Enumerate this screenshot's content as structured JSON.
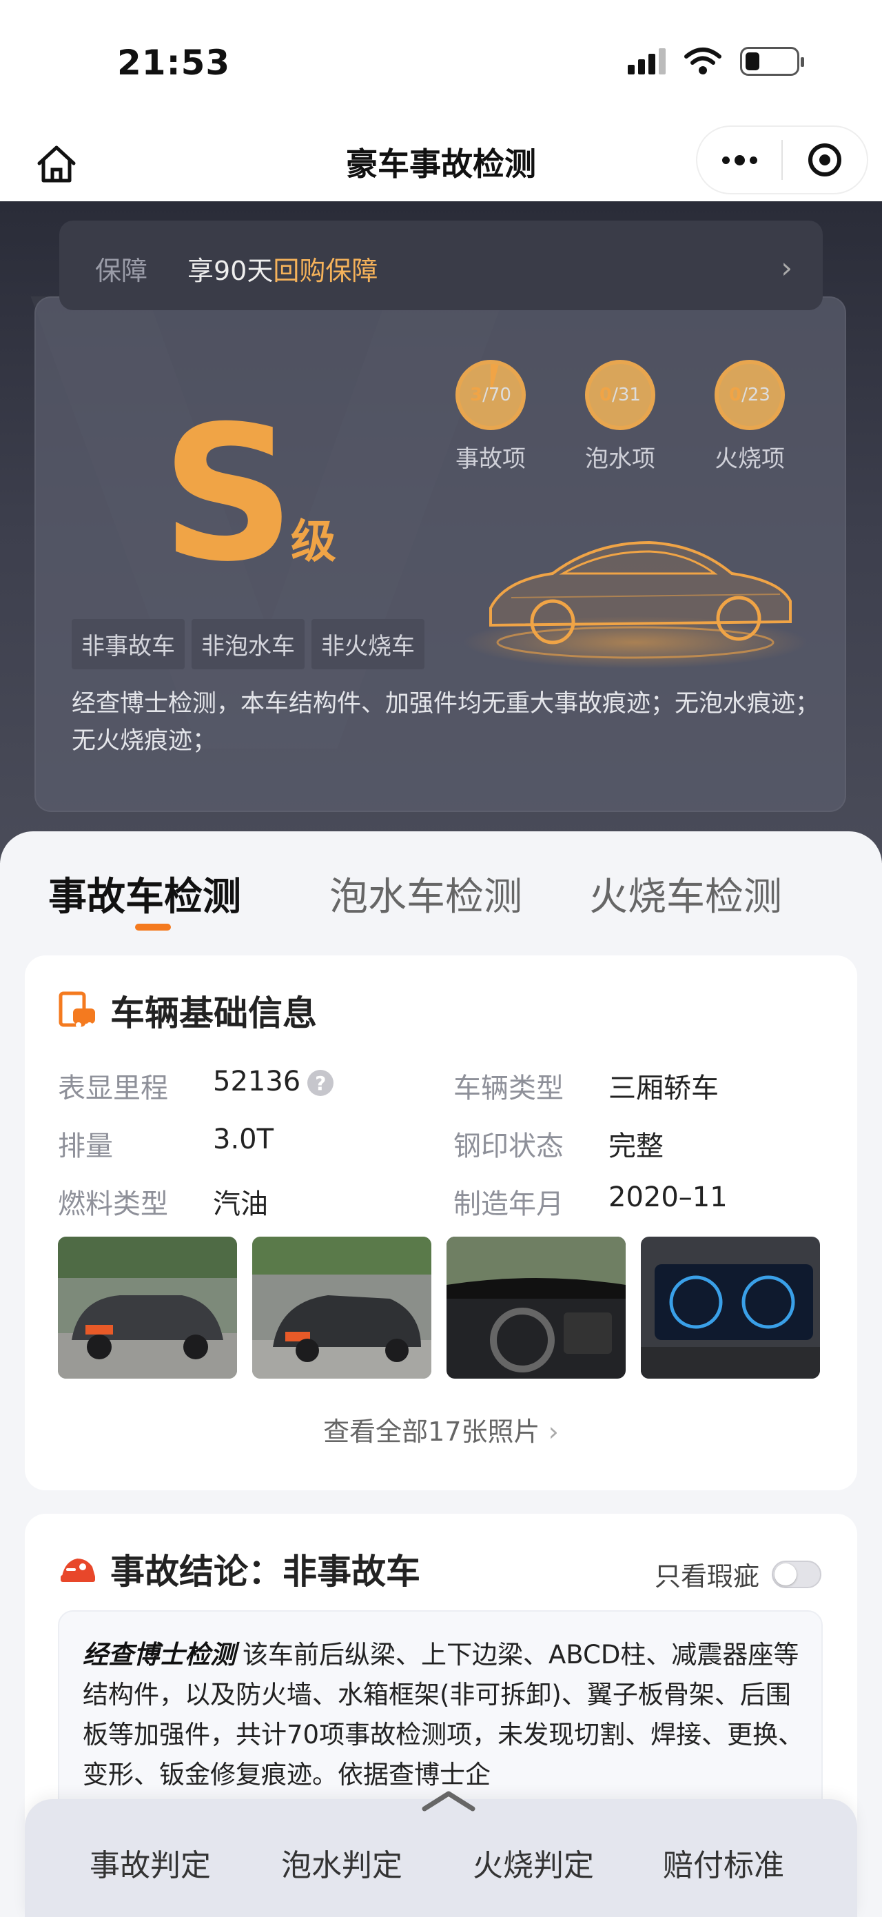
{
  "status_bar": {
    "time": "21:53"
  },
  "nav": {
    "title": "豪车事故检测"
  },
  "guarantee": {
    "label": "保障",
    "text_prefix": "享90天",
    "text_highlight": "回购保障"
  },
  "summary": {
    "grade": "S",
    "grade_suffix": "级",
    "stats": [
      {
        "checked": "3",
        "total": "/70",
        "label": "事故项",
        "fraction": 0.043
      },
      {
        "checked": "0",
        "total": "/31",
        "label": "泡水项",
        "fraction": 0
      },
      {
        "checked": "0",
        "total": "/23",
        "label": "火烧项",
        "fraction": 0
      }
    ],
    "tags": [
      "非事故车",
      "非泡水车",
      "非火烧车"
    ],
    "description": "经查博士检测，本车结构件、加强件均无重大事故痕迹；无泡水痕迹；无火烧痕迹；"
  },
  "tabs": [
    {
      "label": "事故车检测",
      "active": true
    },
    {
      "label": "泡水车检测",
      "active": false
    },
    {
      "label": "火烧车检测",
      "active": false
    }
  ],
  "basic_info": {
    "title": "车辆基础信息",
    "fields": [
      {
        "key": "表显里程",
        "value": "52136"
      },
      {
        "key": "车辆类型",
        "value": "三厢轿车"
      },
      {
        "key": "排量",
        "value": "3.0T"
      },
      {
        "key": "钢印状态",
        "value": "完整"
      },
      {
        "key": "燃料类型",
        "value": "汽油"
      },
      {
        "key": "制造年月",
        "value": "2020–11"
      }
    ],
    "view_all": "查看全部17张照片"
  },
  "conclusion": {
    "title": "事故结论：非事故车",
    "toggle_label": "只看瑕疵",
    "brand": "经查博士检测",
    "text": "该车前后纵梁、上下边梁、ABCD柱、减震器座等结构件，以及防火墙、水箱框架(非可拆卸)、翼子板骨架、后围板等加强件，共计70项事故检测项，未发现切割、焊接、更换、变形、钣金修复痕迹。依据查博士企"
  },
  "bottom_bar": {
    "items": [
      "事故判定",
      "泡水判定",
      "火烧判定",
      "赔付标准"
    ]
  },
  "colors": {
    "accent": "#f0a446",
    "tab_indicator": "#f47a1f",
    "hero_bg": "#2a2c38"
  }
}
